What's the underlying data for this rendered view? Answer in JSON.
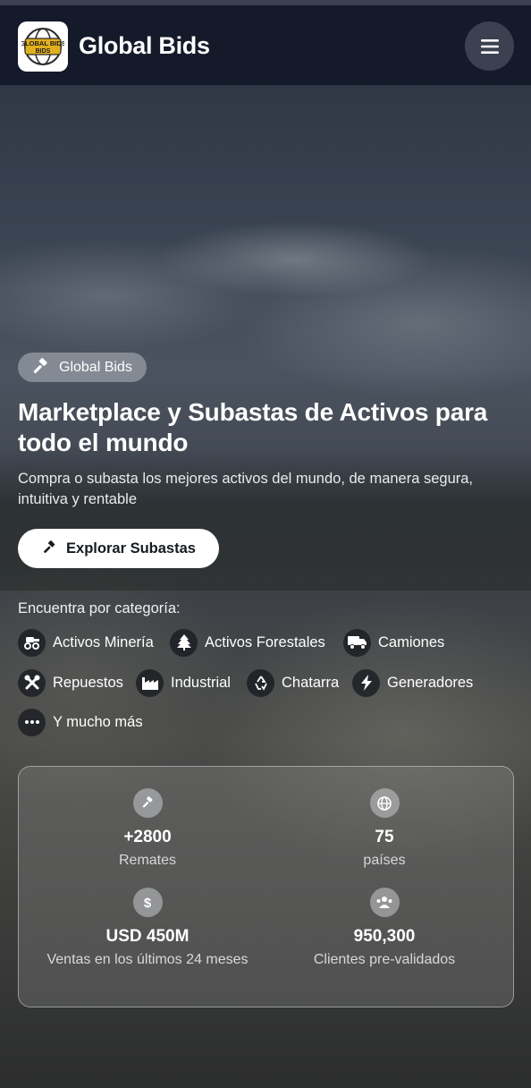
{
  "header": {
    "logo_text": "GLOBAL BIDS",
    "brand": "Global Bids",
    "menu_icon": "hamburger-icon"
  },
  "hero": {
    "badge": "Global Bids",
    "headline": "Marketplace y Subastas de Activos para todo el mundo",
    "subtitle": "Compra o subasta los mejores activos del mundo, de manera segura, intuitiva y rentable",
    "cta": "Explorar Subastas",
    "category_label": "Encuentra por categoría:",
    "categories": [
      {
        "label": "Activos Minería",
        "icon": "excavator-icon"
      },
      {
        "label": "Activos Forestales",
        "icon": "tree-icon"
      },
      {
        "label": "Camiones",
        "icon": "truck-icon"
      },
      {
        "label": "Repuestos",
        "icon": "tools-icon"
      },
      {
        "label": "Industrial",
        "icon": "factory-icon"
      },
      {
        "label": "Chatarra",
        "icon": "recycle-icon"
      },
      {
        "label": "Generadores",
        "icon": "bolt-icon"
      },
      {
        "label": "Y mucho más",
        "icon": "ellipsis-icon"
      }
    ]
  },
  "stats": [
    {
      "value": "+2800",
      "label": "Remates",
      "icon": "gavel-icon"
    },
    {
      "value": "75",
      "label": "países",
      "icon": "globe-icon"
    },
    {
      "value": "USD 450M",
      "label": "Ventas en los últimos 24 meses",
      "icon": "dollar-icon"
    },
    {
      "value": "950,300",
      "label": "Clientes pre-validados",
      "icon": "users-icon"
    }
  ],
  "colors": {
    "header_bg": "#141a2a",
    "cta_bg": "#ffffff",
    "logo_gold": "#e0b020"
  }
}
